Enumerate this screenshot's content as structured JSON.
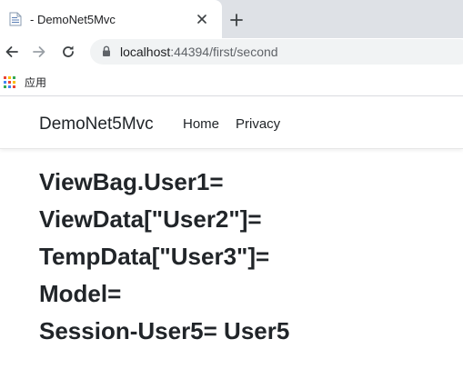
{
  "browser": {
    "tab": {
      "title": "- DemoNet5Mvc"
    },
    "address": {
      "host": "localhost",
      "path": ":44394/first/second"
    },
    "bookmarks": {
      "apps_label": "应用"
    }
  },
  "navbar": {
    "brand": "DemoNet5Mvc",
    "links": [
      "Home",
      "Privacy"
    ]
  },
  "content": {
    "lines": [
      "ViewBag.User1=",
      "ViewData[\"User2\"]=",
      "TempData[\"User3\"]=",
      "Model=",
      "Session-User5= User5"
    ]
  },
  "colors": {
    "tabstrip": "#dee1e6",
    "omnibox": "#f1f3f4",
    "text": "#212529",
    "apps_dots": [
      "#ea4335",
      "#fbbc04",
      "#34a853",
      "#4285f4",
      "#ea4335",
      "#fbbc04",
      "#34a853",
      "#4285f4",
      "#ea4335"
    ]
  },
  "icons": {
    "favicon": "document-icon",
    "close": "close-icon",
    "new_tab": "plus-icon",
    "back": "arrow-left-icon",
    "forward": "arrow-right-icon",
    "reload": "reload-icon",
    "secure": "lock-icon",
    "apps": "apps-grid-icon"
  }
}
